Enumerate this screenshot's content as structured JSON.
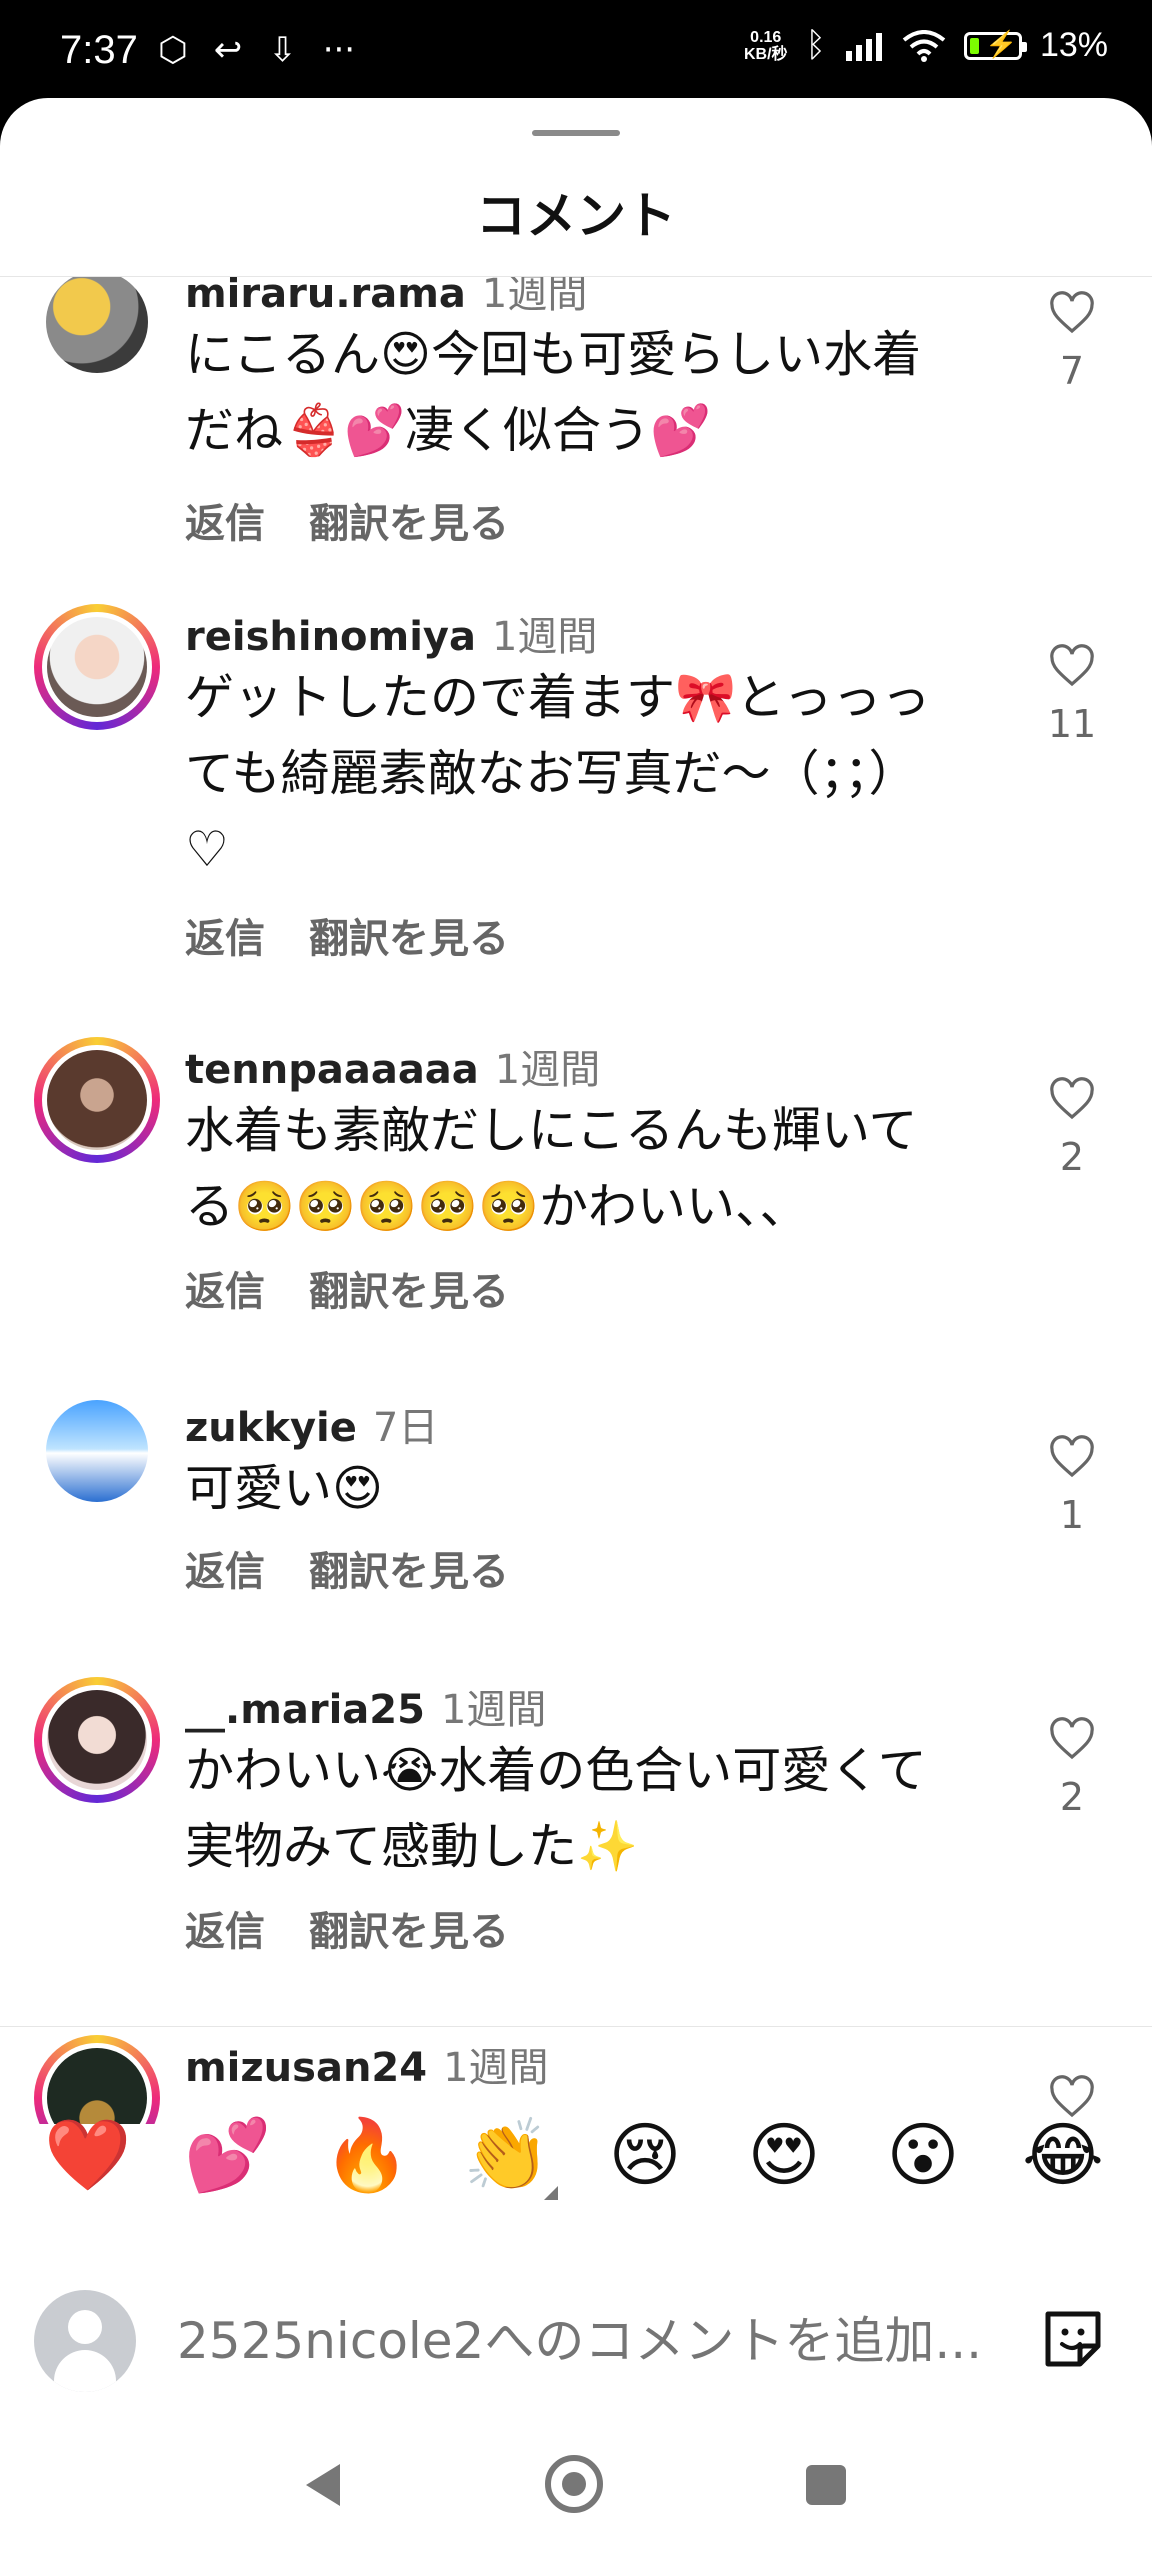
{
  "status_bar": {
    "time": "7:37",
    "net_speed_value": "0.16",
    "net_speed_unit": "KB/秒",
    "battery": "13%",
    "battery_color": "#7CFC00"
  },
  "sheet": {
    "title": "コメント"
  },
  "comments": [
    {
      "user": "miraru.rama",
      "time": "1週間",
      "lines": [
        "にこるん😍今回も可愛らしい水着",
        "だね👙💕凄く似合う💕"
      ],
      "likes": "7",
      "reply": "返信",
      "translate": "翻訳を見る"
    },
    {
      "user": "reishinomiya",
      "time": "1週間",
      "lines": [
        "ゲットしたので着ます🎀とっっっ",
        "ても綺麗素敵なお写真だ〜（；；）",
        "♡"
      ],
      "likes": "11",
      "reply": "返信",
      "translate": "翻訳を見る"
    },
    {
      "user": "tennpaaaaaa",
      "time": "1週間",
      "lines": [
        "水着も素敵だしにこるんも輝いて",
        "る🥺🥺🥺🥺🥺かわいい、、"
      ],
      "likes": "2",
      "reply": "返信",
      "translate": "翻訳を見る"
    },
    {
      "user": "zukkyie",
      "time": "7日",
      "lines": [
        "可愛い😍"
      ],
      "likes": "1",
      "reply": "返信",
      "translate": "翻訳を見る"
    },
    {
      "user": "__.maria25",
      "time": "1週間",
      "lines": [
        "かわいい😭水着の色合い可愛くて",
        "実物みて感動した✨"
      ],
      "likes": "2",
      "reply": "返信",
      "translate": "翻訳を見る"
    },
    {
      "user": "mizusan24",
      "time": "1週間",
      "lines": [],
      "likes": "",
      "reply": "",
      "translate": ""
    }
  ],
  "quick_reactions": [
    "❤️",
    "💕",
    "🔥",
    "👏",
    "😢",
    "😍",
    "😮",
    "😂"
  ],
  "comment_box": {
    "placeholder": "2525nicole2へのコメントを追加..."
  }
}
